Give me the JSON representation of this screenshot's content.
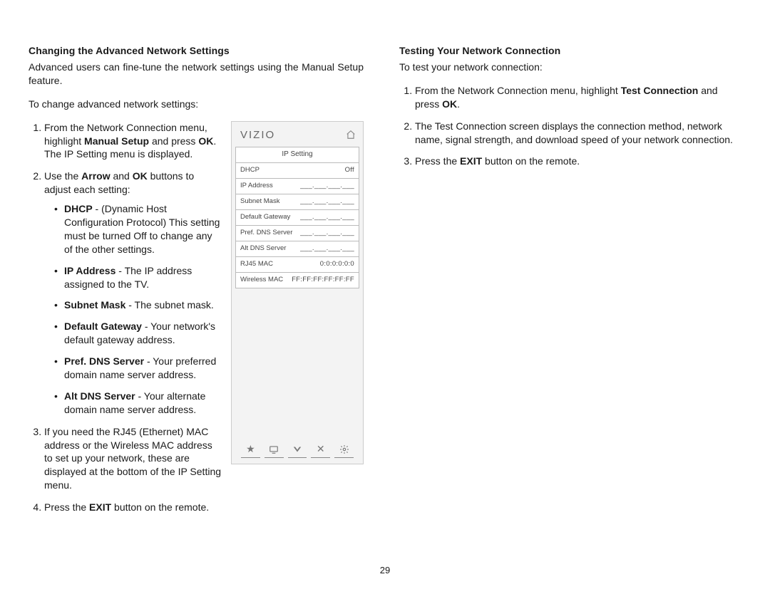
{
  "page_number": "29",
  "left": {
    "heading": "Changing the Advanced Network Settings",
    "intro": "Advanced users can fine-tune the network settings using the Manual Setup feature.",
    "lead": "To change advanced network settings:",
    "steps": {
      "s1a": "From the Network Connection menu, highlight ",
      "s1b": "Manual Setup",
      "s1c": " and press ",
      "s1d": "OK",
      "s1e": ". The IP Setting menu is displayed.",
      "s2a": "Use the ",
      "s2b": "Arrow",
      "s2c": " and ",
      "s2d": "OK",
      "s2e": " buttons to adjust each setting:",
      "b1t": "DHCP",
      "b1": " - (Dynamic Host Configuration Protocol) This setting must be turned Off to change any of the other settings.",
      "b2t": "IP Address",
      "b2": " - The IP address assigned to the TV.",
      "b3t": "Subnet Mask",
      "b3": " - The subnet mask.",
      "b4t": "Default Gateway",
      "b4": " - Your network's default gateway address.",
      "b5t": "Pref. DNS Server",
      "b5": " - Your preferred domain name server address.",
      "b6t": "Alt DNS Server",
      "b6": " - Your alternate domain name server address.",
      "s3": "If you need the RJ45 (Ethernet) MAC address or the Wireless MAC address to set up your network, these are displayed at the bottom of the IP Setting menu.",
      "s4a": "Press the ",
      "s4b": "EXIT",
      "s4c": " button on the remote."
    }
  },
  "right": {
    "heading": "Testing Your Network Connection",
    "intro": "To test your network connection:",
    "s1a": "From the Network Connection menu, highlight ",
    "s1b": "Test Connection",
    "s1c": " and press ",
    "s1d": "OK",
    "s1e": ".",
    "s2": "The Test Connection screen displays the connection method, network name, signal strength, and download speed of your network connection.",
    "s3a": "Press the ",
    "s3b": "EXIT",
    "s3c": " button on the remote."
  },
  "tv": {
    "brand": "VIZIO",
    "title": "IP Setting",
    "rows": [
      {
        "label": "DHCP",
        "value": "Off"
      },
      {
        "label": "IP Address",
        "value": "___.___.___.___"
      },
      {
        "label": "Subnet Mask",
        "value": "___.___.___.___"
      },
      {
        "label": "Default Gateway",
        "value": "___.___.___.___"
      },
      {
        "label": "Pref. DNS Server",
        "value": "___.___.___.___"
      },
      {
        "label": "Alt DNS Server",
        "value": "___.___.___.___"
      },
      {
        "label": "RJ45 MAC",
        "value": "0:0:0:0:0:0"
      },
      {
        "label": "Wireless MAC",
        "value": "FF:FF:FF:FF:FF:FF"
      }
    ]
  }
}
